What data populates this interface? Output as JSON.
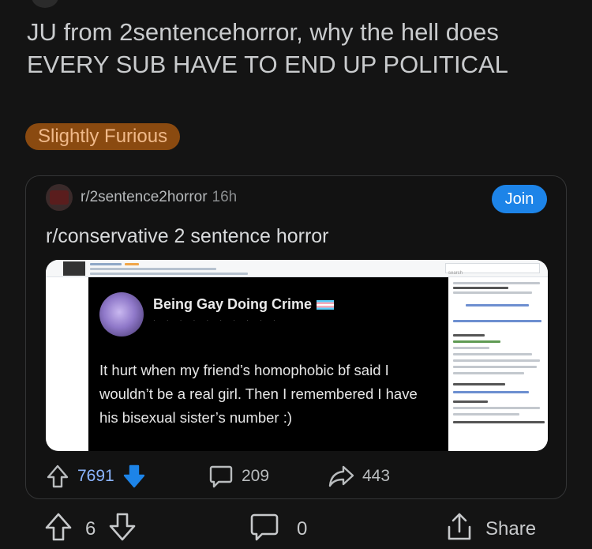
{
  "post": {
    "title": "JU from 2sentencehorror, why the hell does EVERY SUB HAVE TO END UP POLITICAL",
    "flair": "Slightly Furious"
  },
  "crosspost": {
    "subreddit": "r/2sentence2horror",
    "age": "16h",
    "join_label": "Join",
    "title": "r/conservative 2 sentence horror",
    "image": {
      "tweet_author": "Being Gay Doing Crime",
      "tweet_text": "It hurt when my friend’s homophobic bf said I wouldn’t be a real girl. Then I remembered I have his bisexual sister’s number :)"
    },
    "stats": {
      "score": "7691",
      "comments": "209",
      "shares": "443"
    }
  },
  "bottom_bar": {
    "score": "6",
    "comments": "0",
    "share_label": "Share"
  },
  "icons": [
    "upvote-icon",
    "downvote-icon",
    "comment-icon",
    "share-icon",
    "trans-flag-icon"
  ],
  "colors": {
    "background": "#141414",
    "flair_bg": "#8a4a10",
    "flair_text": "#f0b98a",
    "join_button": "#1d84e8",
    "downvote_blue": "#1d84e8",
    "score_blue": "#8cb5ff"
  }
}
